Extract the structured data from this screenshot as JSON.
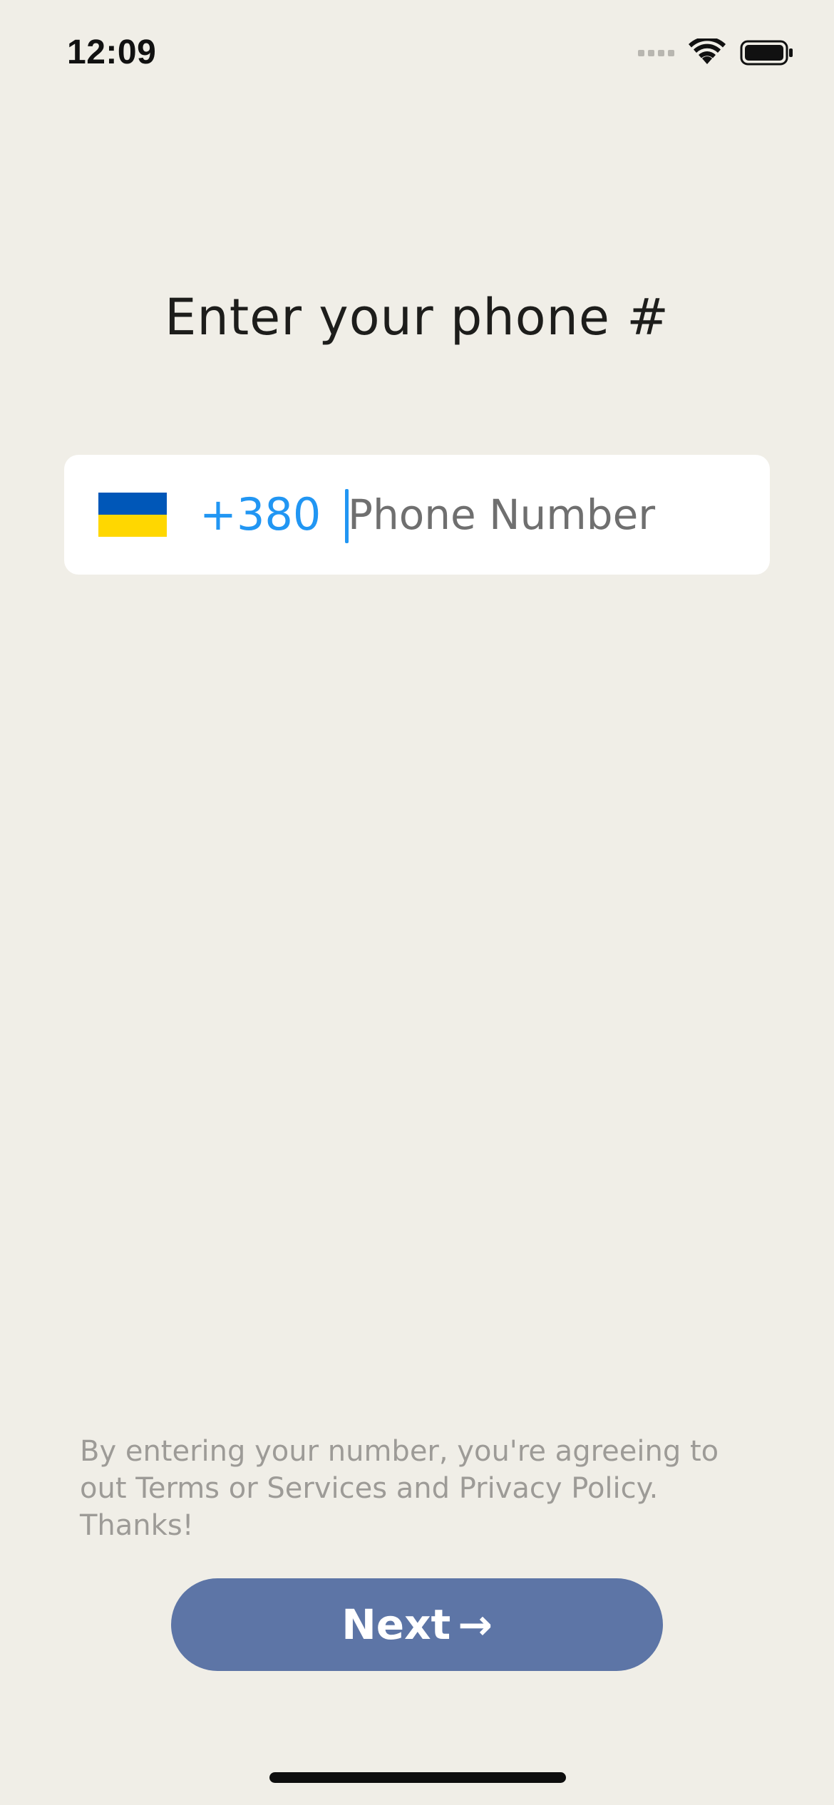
{
  "status_bar": {
    "time": "12:09",
    "icons": [
      "cellular-signal-icon",
      "wifi-icon",
      "battery-icon"
    ]
  },
  "header": {
    "title": "Enter your phone #"
  },
  "phone_field": {
    "country_flag": "flag-ukraine-icon",
    "flag_colors": [
      "#0057B8",
      "#FFD700"
    ],
    "dial_code": "+380",
    "value": "",
    "placeholder": "Phone Number"
  },
  "footer": {
    "terms": "By entering your number, you're agreeing to out Terms or Services and Privacy Policy. Thanks!"
  },
  "actions": {
    "next_label": "Next",
    "next_icon": "→",
    "next_color": "#5D75A6"
  },
  "colors": {
    "background": "#F0EEE7",
    "accent": "#2196F3"
  }
}
